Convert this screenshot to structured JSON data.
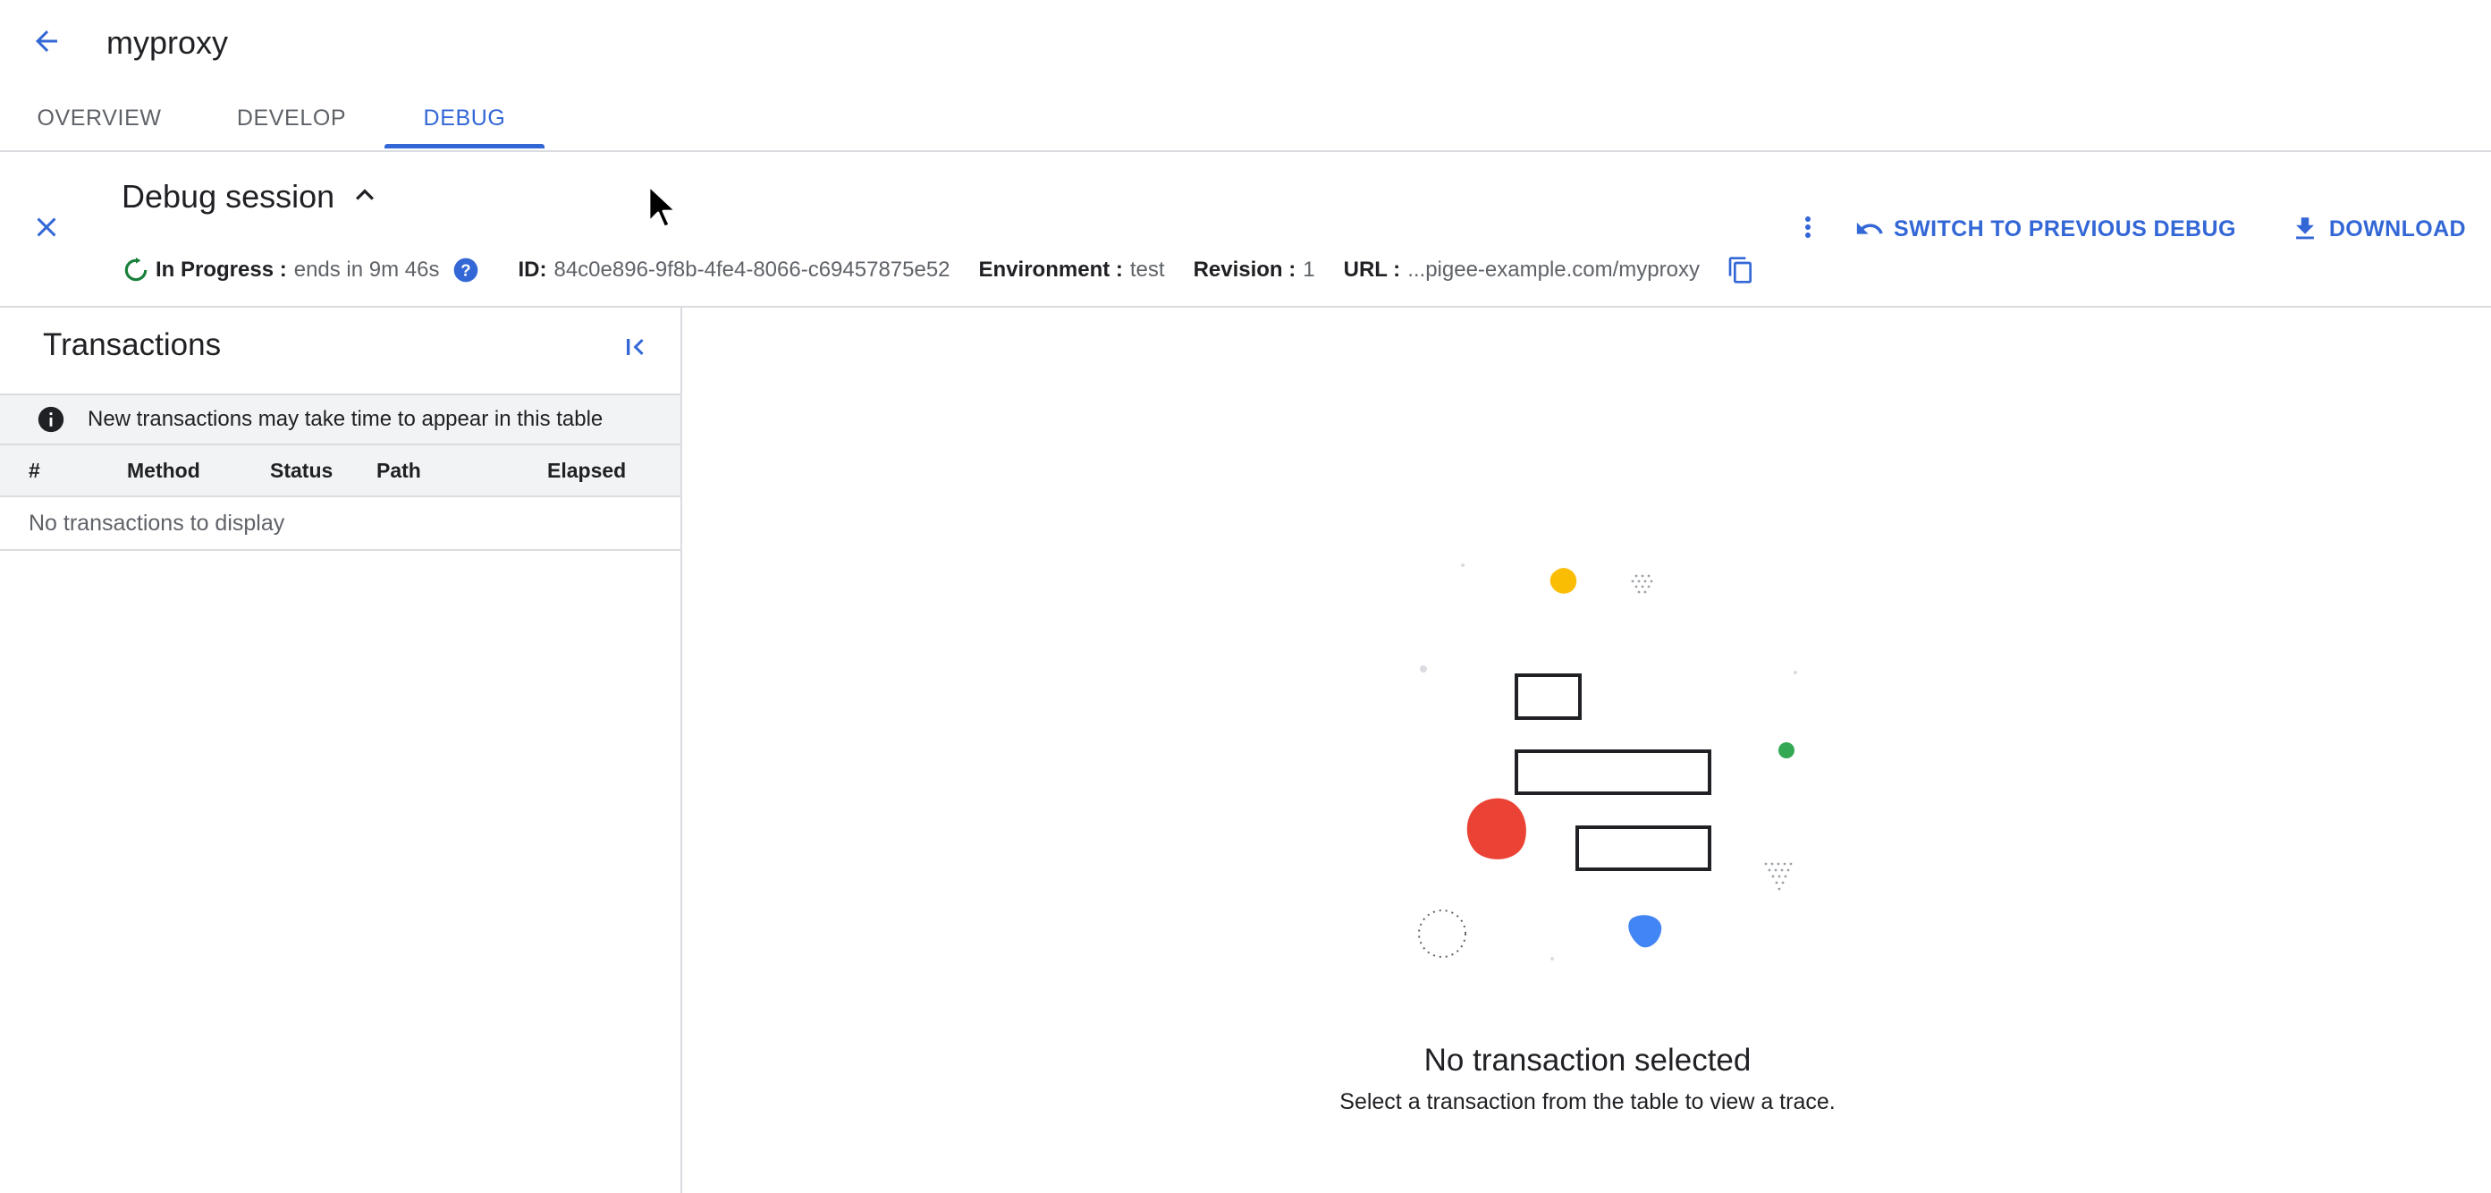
{
  "header": {
    "title": "myproxy"
  },
  "tabs": [
    {
      "label": "OVERVIEW"
    },
    {
      "label": "DEVELOP"
    },
    {
      "label": "DEBUG"
    }
  ],
  "active_tab": "DEBUG",
  "session": {
    "title": "Debug session",
    "status_label": "In Progress :",
    "status_value": "ends in 9m 46s",
    "id_label": "ID:",
    "id_value": "84c0e896-9f8b-4fe4-8066-c69457875e52",
    "env_label": "Environment :",
    "env_value": "test",
    "revision_label": "Revision :",
    "revision_value": "1",
    "url_label": "URL :",
    "url_value": "...pigee-example.com/myproxy"
  },
  "actions": {
    "switch_label": "SWITCH TO PREVIOUS DEBUG",
    "download_label": "DOWNLOAD"
  },
  "transactions": {
    "title": "Transactions",
    "notice": "New transactions may take time to appear in this table",
    "columns": [
      "#",
      "Method",
      "Status",
      "Path",
      "Elapsed"
    ],
    "empty_text": "No transactions to display"
  },
  "detail": {
    "empty_title": "No transaction selected",
    "empty_subtitle": "Select a transaction from the table to view a trace."
  },
  "colors": {
    "accent": "#3367d6",
    "progress_green": "#188038",
    "illus_yellow": "#fbbc04",
    "illus_red": "#ea4335",
    "illus_blue": "#4285f4",
    "illus_green": "#34a853"
  },
  "icons": {
    "back": "arrow-back-icon",
    "close": "close-icon",
    "toggle": "chevron-up-icon",
    "status": "progress-icon",
    "help": "help-icon",
    "copy": "copy-icon",
    "more": "more-vert-icon",
    "switch": "undo-icon",
    "download": "download-icon",
    "collapse": "collapse-left-icon",
    "info": "info-icon"
  }
}
